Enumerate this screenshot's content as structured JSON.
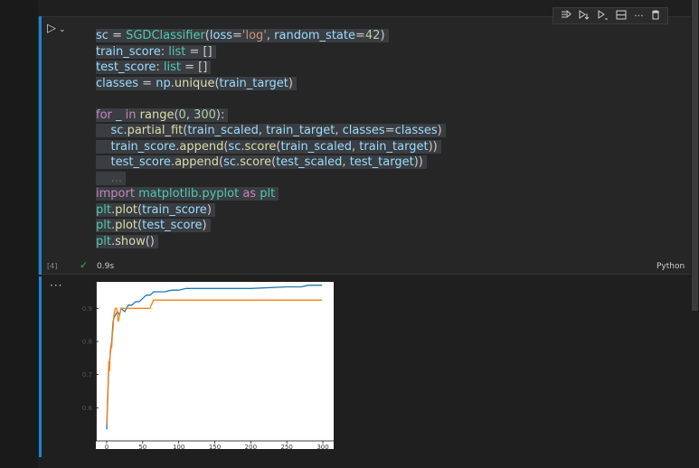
{
  "toolbar": {
    "icons": [
      "run-by-line-icon",
      "execute-above-icon",
      "execute-below-icon",
      "split-cell-icon",
      "more-icon",
      "delete-icon"
    ]
  },
  "cell": {
    "run_icon": "▷",
    "chevron": "⌄",
    "execution_count": "[4]",
    "status_check": "✓",
    "elapsed": "0.9s",
    "language": "Python",
    "code_lines": [
      "sc = SGDClassifier(loss='log', random_state=42)",
      "train_score: list = []",
      "test_score: list = []",
      "classes = np.unique(train_target)",
      "",
      "for _ in range(0, 300):",
      "    sc.partial_fit(train_scaled, train_target, classes=classes)",
      "    train_score.append(sc.score(train_scaled, train_target))",
      "    test_score.append(sc.score(test_scaled, test_target))",
      "    ...",
      "import matplotlib.pyplot as plt",
      "plt.plot(train_score)",
      "plt.plot(test_score)",
      "plt.show()"
    ]
  },
  "output": {
    "menu_dots": "···"
  },
  "colors": {
    "series_train": "#1f77b4",
    "series_test": "#ff7f0e",
    "focus_bar": "#1a85d6"
  },
  "chart_data": {
    "type": "line",
    "title": "",
    "xlabel": "",
    "ylabel": "",
    "xlim": [
      -15,
      315
    ],
    "ylim": [
      0.5,
      0.98
    ],
    "xticks": [
      0,
      50,
      100,
      150,
      200,
      250,
      300
    ],
    "xtick_labels": [
      "0",
      "50",
      "100",
      "150",
      "200",
      "250",
      "300"
    ],
    "yticks": [
      0.6,
      0.7,
      0.8,
      0.9
    ],
    "ytick_labels": [
      "0.6",
      "0.7",
      "0.8",
      "0.9"
    ],
    "grid": false,
    "legend": "none",
    "series": [
      {
        "x": [
          0,
          1,
          2,
          3,
          4,
          5,
          6,
          7,
          8,
          9,
          10,
          12,
          15,
          18,
          20,
          25,
          30,
          35,
          40,
          45,
          50,
          55,
          60,
          65,
          70,
          80,
          90,
          100,
          110,
          120,
          150,
          200,
          250,
          270,
          280,
          299
        ],
        "y": [
          0.535,
          0.6,
          0.655,
          0.72,
          0.74,
          0.76,
          0.78,
          0.8,
          0.83,
          0.86,
          0.87,
          0.88,
          0.89,
          0.88,
          0.9,
          0.89,
          0.91,
          0.91,
          0.92,
          0.92,
          0.93,
          0.94,
          0.94,
          0.95,
          0.95,
          0.95,
          0.955,
          0.955,
          0.96,
          0.96,
          0.96,
          0.96,
          0.965,
          0.965,
          0.97,
          0.97
        ]
      },
      {
        "x": [
          0,
          1,
          2,
          3,
          4,
          5,
          6,
          7,
          8,
          9,
          10,
          12,
          14,
          16,
          20,
          30,
          40,
          50,
          60,
          65,
          70,
          100,
          150,
          200,
          250,
          299
        ],
        "y": [
          0.55,
          0.62,
          0.67,
          0.74,
          0.71,
          0.77,
          0.79,
          0.78,
          0.82,
          0.84,
          0.88,
          0.9,
          0.9,
          0.86,
          0.9,
          0.9,
          0.9,
          0.9,
          0.9,
          0.925,
          0.925,
          0.925,
          0.925,
          0.925,
          0.925,
          0.925
        ]
      }
    ]
  }
}
